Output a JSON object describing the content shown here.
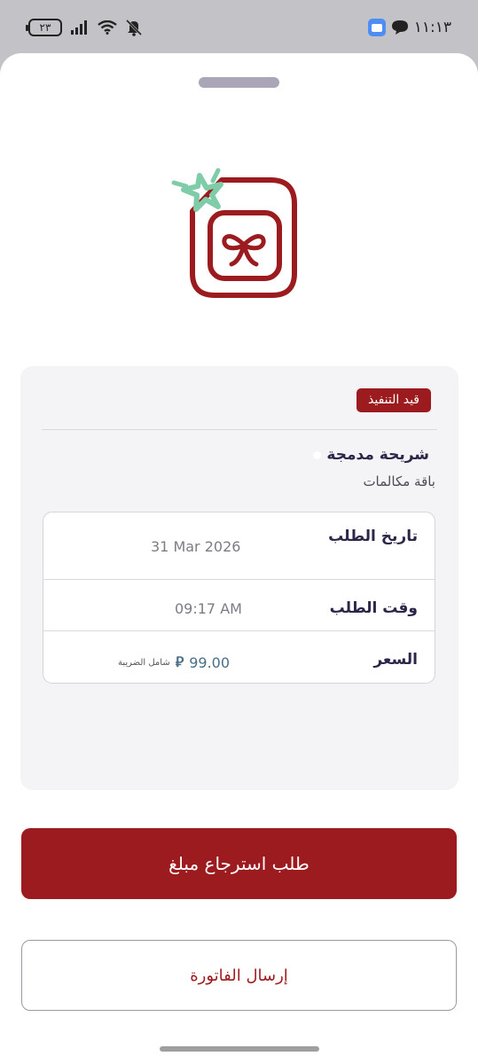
{
  "status_bar": {
    "time": "١١:١٣",
    "battery": "٢٣",
    "icons": [
      "app-icon",
      "chat-icon",
      "signal-icon",
      "wifi-icon",
      "mute-icon"
    ]
  },
  "order": {
    "status_badge": "قيد التنفيذ",
    "product_name": "شريحة مدمجة",
    "product_subtitle": "باقة مكالمات",
    "details": {
      "date_label": "تاريخ الطلب",
      "date_value": "31 Mar 2026",
      "time_label": "وقت الطلب",
      "time_value": "09:17 AM",
      "price_label": "السعر",
      "price_value": "99.00",
      "price_currency_symbol": "⃁",
      "price_note": "شامل الضريبة"
    }
  },
  "actions": {
    "refund_label": "طلب استرجاع مبلغ",
    "send_invoice_label": "إرسال الفاتورة"
  },
  "colors": {
    "brand": "#9b1b1e",
    "accent_star": "#7fcca8",
    "title_text": "#2c2649",
    "card_bg": "#f4f4f7"
  }
}
